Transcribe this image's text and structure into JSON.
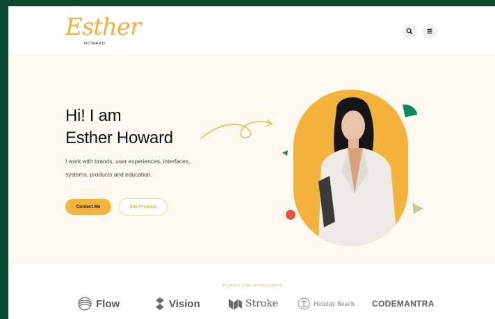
{
  "brand": {
    "logo_script": "Esther",
    "logo_sub": "HOWARD"
  },
  "header": {
    "search_icon": "search-icon",
    "menu_icon": "hamburger-menu-icon"
  },
  "hero": {
    "greeting": "Hi! I am",
    "name": "Esther Howard",
    "description_line1": "I work with brands, user experiences, interfaces,",
    "description_line2": "systems, products and education.",
    "contact_button": "Contact Me",
    "projects_button": "See Projects"
  },
  "brands": {
    "title": "BRANDS I HAVE WORKED WITH",
    "items": [
      {
        "label": "Flow",
        "icon": "flow-icon"
      },
      {
        "label": "Vision",
        "icon": "vision-icon"
      },
      {
        "label": "Stroke",
        "icon": "stroke-icon"
      },
      {
        "label": "Holiday Beach",
        "icon": "holiday-beach-icon"
      },
      {
        "label": "CODEMANTRA",
        "icon": ""
      }
    ]
  },
  "colors": {
    "frame": "#0d4a32",
    "accent": "#f5b53d",
    "hero_bg": "#fbf9f0",
    "green_shape": "#0f8a5f",
    "red_shape": "#e2543f"
  }
}
